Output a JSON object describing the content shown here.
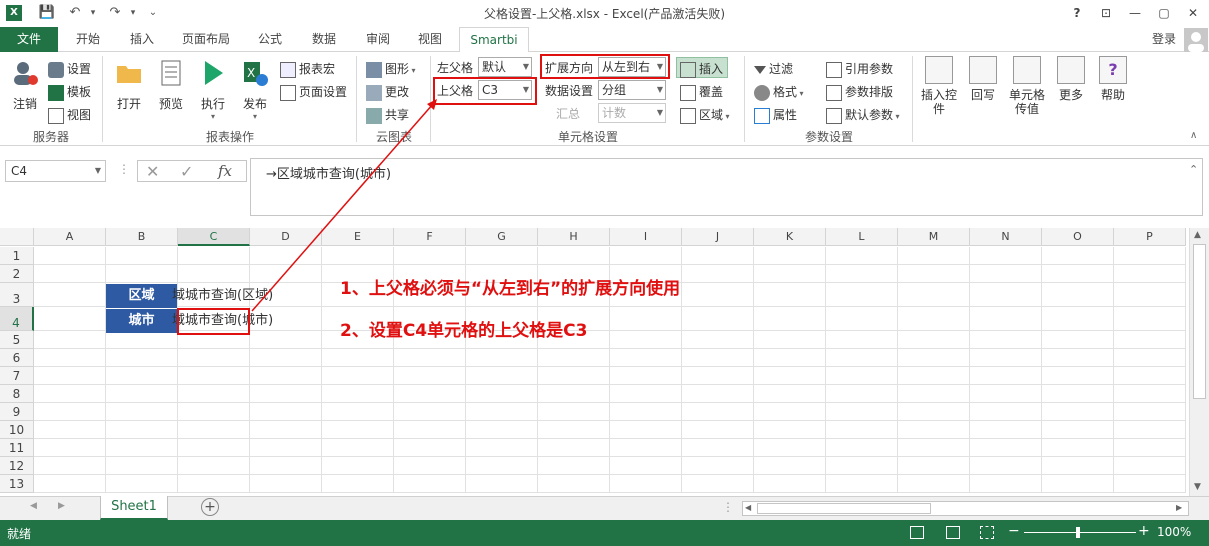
{
  "window": {
    "title": "父格设置-上父格.xlsx - Excel(产品激活失败)",
    "app_icon": "X",
    "help": "?",
    "controls": [
      "⊡",
      "—",
      "▢",
      "✕"
    ]
  },
  "quick_access": {
    "save": "save-icon",
    "undo": "undo-icon",
    "redo": "redo-icon"
  },
  "tabs": [
    "文件",
    "开始",
    "插入",
    "页面布局",
    "公式",
    "数据",
    "审阅",
    "视图",
    "Smartbi"
  ],
  "login": "登录",
  "ribbon": {
    "server": {
      "label": "服务器",
      "login": "注销",
      "settings": "设置",
      "template": "模板",
      "view": "视图"
    },
    "report": {
      "label": "报表操作",
      "open": "打开",
      "preview": "预览",
      "execute": "执行",
      "publish": "发布",
      "macro": "报表宏",
      "page_setup": "页面设置"
    },
    "cloud": {
      "label": "云图表",
      "graphic": "图形",
      "change": "更改",
      "share": "共享"
    },
    "cell": {
      "label": "单元格设置",
      "left_parent_label": "左父格",
      "left_parent_value": "默认",
      "top_parent_label": "上父格",
      "top_parent_value": "C3",
      "expand_label": "扩展方向",
      "expand_value": "从左到右",
      "data_setting_label": "数据设置",
      "data_setting_value": "分组",
      "summary_label": "汇总",
      "summary_value": "计数",
      "insert": "插入",
      "cover": "覆盖",
      "region": "区域"
    },
    "param": {
      "label": "参数设置",
      "filter": "过滤",
      "format": "格式",
      "attribute": "属性",
      "ref_param": "引用参数",
      "param_sort": "参数排版",
      "default_param": "默认参数"
    },
    "insert_ctrl": "插入控件",
    "writeback": "回写",
    "cell_pass": "单元格传值",
    "more": "更多",
    "help": "帮助"
  },
  "formula_bar": {
    "name_box": "C4",
    "formula": "→区域城市查询(城市)",
    "fx": "fx"
  },
  "columns": [
    "A",
    "B",
    "C",
    "D",
    "E",
    "F",
    "G",
    "H",
    "I",
    "J",
    "K",
    "L",
    "M",
    "N",
    "O",
    "P"
  ],
  "rows": [
    "1",
    "2",
    "3",
    "4",
    "5",
    "6",
    "7",
    "8",
    "9",
    "10",
    "11",
    "12",
    "13"
  ],
  "cells": {
    "B3": "区域",
    "C3": "域城市查询(区域)",
    "B4": "城市",
    "C4": "域城市查询(城市)"
  },
  "annotations": [
    "1、上父格必须与“从左到右”的扩展方向使用",
    "2、设置C4单元格的上父格是C3"
  ],
  "sheet_tab": "Sheet1",
  "status": {
    "ready": "就绪",
    "zoom": "100%"
  },
  "colors": {
    "excel_green": "#217346",
    "header_blue": "#2e5aa3",
    "annotation_red": "#e01010"
  }
}
